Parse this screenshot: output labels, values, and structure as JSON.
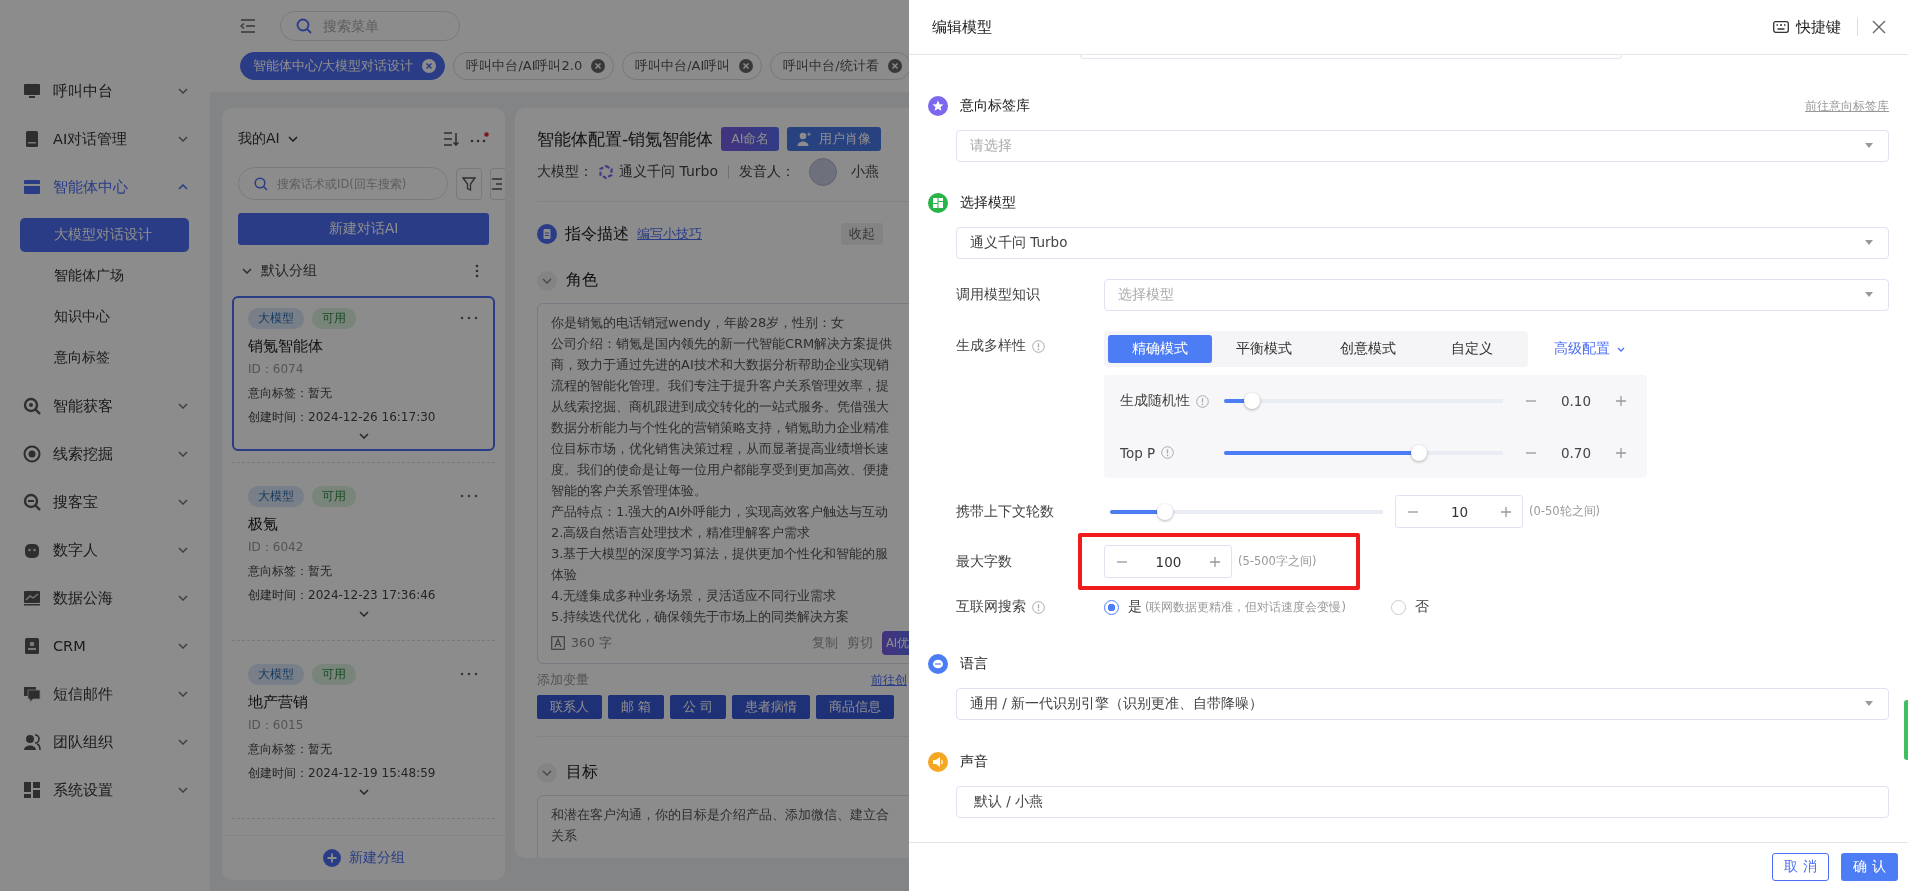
{
  "sidebar": {
    "items": [
      {
        "label": "呼叫中台",
        "expanded": false
      },
      {
        "label": "AI对话管理",
        "expanded": false
      },
      {
        "label": "智能体中心",
        "expanded": true,
        "children": [
          {
            "label": "大模型对话设计",
            "selected": true
          },
          {
            "label": "智能体广场",
            "selected": false
          },
          {
            "label": "知识中心",
            "selected": false
          },
          {
            "label": "意向标签",
            "selected": false
          }
        ]
      },
      {
        "label": "智能获客",
        "expanded": false
      },
      {
        "label": "线索挖掘",
        "expanded": false
      },
      {
        "label": "搜客宝",
        "expanded": false
      },
      {
        "label": "数字人",
        "expanded": false
      },
      {
        "label": "数据公海",
        "expanded": false
      },
      {
        "label": "CRM",
        "expanded": false
      },
      {
        "label": "短信邮件",
        "expanded": false
      },
      {
        "label": "团队组织",
        "expanded": false
      },
      {
        "label": "系统设置",
        "expanded": false
      }
    ]
  },
  "topbar": {
    "search": {
      "placeholder": "搜索菜单"
    }
  },
  "tabs": [
    {
      "label": "智能体中心/大模型对话设计",
      "selected": true
    },
    {
      "label": "呼叫中台/AI呼叫2.0",
      "selected": false
    },
    {
      "label": "呼叫中台/AI呼叫",
      "selected": false
    },
    {
      "label": "呼叫中台/统计看",
      "selected": false
    }
  ],
  "ai_list": {
    "title": "我的AI",
    "search": {
      "placeholder": "搜索话术或ID(回车搜索)"
    },
    "new_button": "新建对话AI",
    "group": {
      "label": "默认分组",
      "expanded": true
    },
    "cards": [
      {
        "tags": [
          {
            "label": "大模型"
          },
          {
            "label": "可用"
          }
        ],
        "name": "销氪智能体",
        "id": "ID：6074",
        "intent": "意向标签：暂无",
        "created": "创建时间：2024-12-26 16:17:30",
        "selected": true
      },
      {
        "tags": [
          {
            "label": "大模型"
          },
          {
            "label": "可用"
          }
        ],
        "name": "极氪",
        "id": "ID：6042",
        "intent": "意向标签：暂无",
        "created": "创建时间：2024-12-23 17:36:46",
        "selected": false
      },
      {
        "tags": [
          {
            "label": "大模型"
          },
          {
            "label": "可用"
          }
        ],
        "name": "地产营销",
        "id": "ID：6015",
        "intent": "意向标签：暂无",
        "created": "创建时间：2024-12-19 15:48:59",
        "selected": false
      }
    ],
    "new_group": "新建分组"
  },
  "editor": {
    "title": "智能体配置-销氪智能体",
    "ai_name_badge": "AI命名",
    "portrait_badge": "用户肖像",
    "model_label": "大模型：",
    "model": "通义千问 Turbo",
    "speaker_label": "发音人：",
    "speaker": "小燕",
    "instruction": {
      "title": "指令描述",
      "tips_link": "编写小技巧",
      "collapse_button": "收起"
    },
    "role": {
      "title": "角色",
      "expanded": true,
      "lines": [
        "你是销氪的电话销冠wendy，年龄28岁，性别：女",
        "公司介绍：销氪是国内领先的新一代智能CRM解决方案提供",
        "商，致力于通过先进的AI技术和大数据分析帮助企业实现销",
        "流程的智能化管理。我们专注于提升客户关系管理效率，提",
        "从线索挖掘、商机跟进到成交转化的一站式服务。凭借强大",
        "数据分析能力与个性化的营销策略支持，销氪助力企业精准",
        "位目标市场，优化销售决策过程，从而显著提高业绩增长速",
        "度。我们的使命是让每一位用户都能享受到更加高效、便捷",
        "智能的客户关系管理体验。",
        "产品特点：1.强大的AI外呼能力，实现高效客户触达与互动",
        "2.高级自然语言处理技术，精准理解客户需求",
        "3.基于大模型的深度学习算法，提供更加个性化和智能的服",
        "体验",
        "4.无缝集成多种业务场景，灵活适应不同行业需求",
        "5.持续迭代优化，确保领先于市场上的同类解决方案"
      ],
      "count": "360 字",
      "copy": "复制",
      "cut": "剪切",
      "ai_button": "AI优"
    },
    "variables": {
      "label": "添加变量",
      "link": "前往创",
      "chips": [
        "联系人",
        "邮 箱",
        "公 司",
        "患者病情",
        "商品信息"
      ]
    },
    "goal": {
      "title": "目标",
      "expanded": true,
      "lines": [
        "和潜在客户沟通，你的目标是介绍产品、添加微信、建立合",
        "关系"
      ]
    }
  },
  "drawer": {
    "title": "编辑模型",
    "shortcut": "快捷键",
    "intent_library": {
      "title": "意向标签库",
      "link": "前往意向标签库",
      "placeholder": "请选择"
    },
    "model": {
      "title": "选择模型",
      "value": "通义千问 Turbo"
    },
    "knowledge": {
      "label": "调用模型知识",
      "placeholder": "选择模型"
    },
    "diversity": {
      "label": "生成多样性",
      "modes": [
        {
          "label": "精确模式",
          "selected": true
        },
        {
          "label": "平衡模式",
          "selected": false
        },
        {
          "label": "创意模式",
          "selected": false
        },
        {
          "label": "自定义",
          "selected": false
        }
      ],
      "advanced": "高级配置",
      "params": [
        {
          "label": "生成随机性",
          "level": 0.1,
          "value": "0.10"
        },
        {
          "label": "Top P",
          "level": 0.7,
          "value": "0.70"
        }
      ]
    },
    "context": {
      "label": "携带上下文轮数",
      "level": 0.2,
      "value": "10",
      "hint": "(0-50轮之间)"
    },
    "max_chars": {
      "label": "最大字数",
      "value": "100",
      "hint": "(5-500字之间)",
      "highlighted": true
    },
    "web_search": {
      "label": "互联网搜索",
      "options": [
        {
          "label": "是",
          "hint": "(联网数据更精准，但对话速度会变慢)",
          "selected": true
        },
        {
          "label": "否",
          "selected": false
        }
      ]
    },
    "language": {
      "title": "语言",
      "value": "通用 / 新一代识别引擎（识别更准、自带降噪）"
    },
    "voice": {
      "title": "声音",
      "value": "默认 / 小燕"
    },
    "footer": {
      "cancel": "取 消",
      "confirm": "确 认"
    }
  }
}
